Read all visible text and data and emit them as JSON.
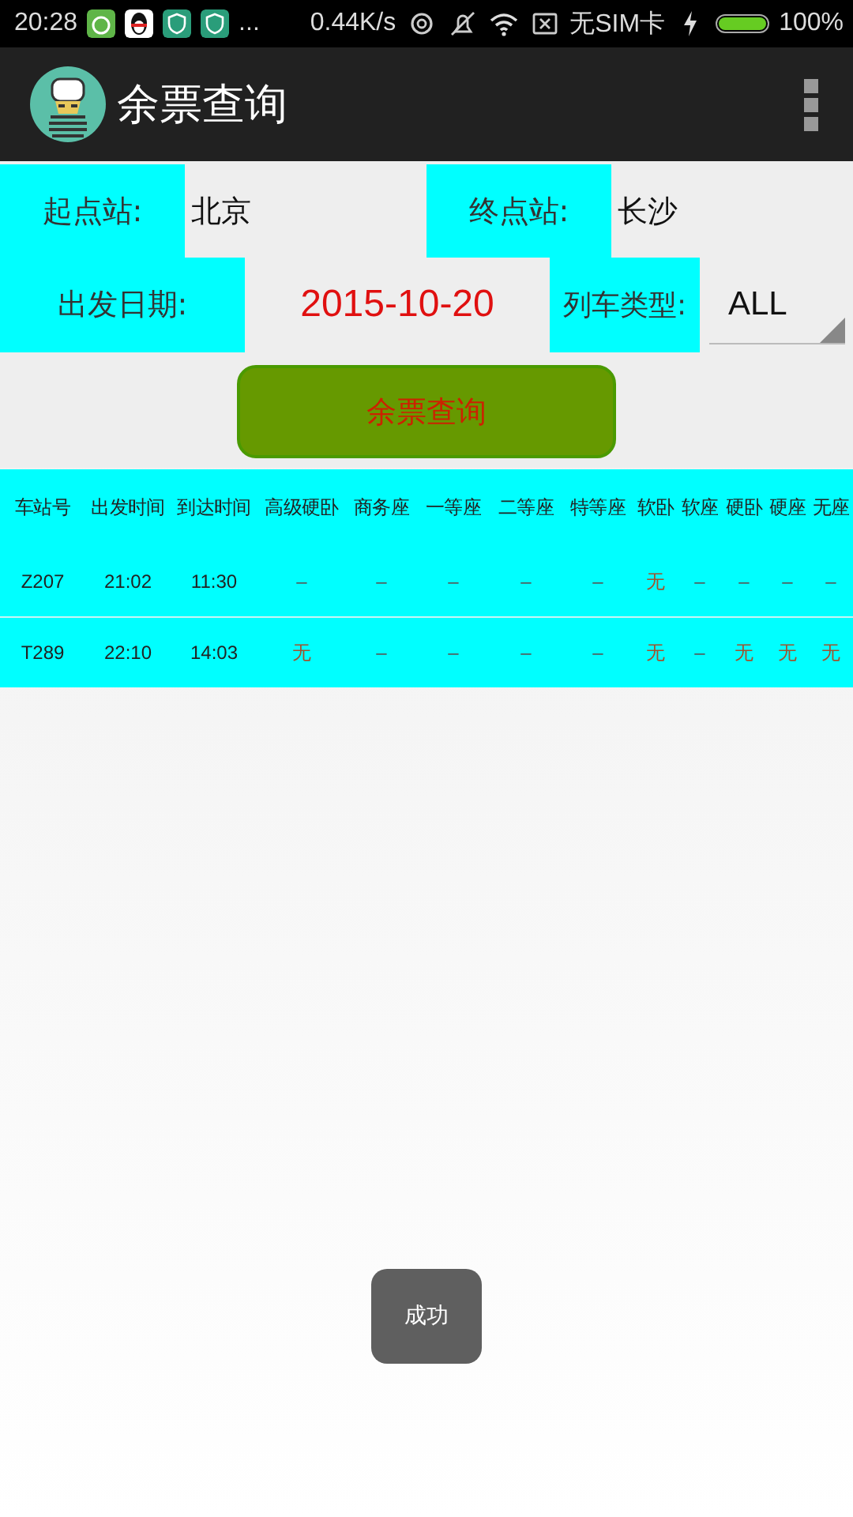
{
  "status_bar": {
    "time": "20:28",
    "more": "...",
    "speed": "0.44K/s",
    "sim": "无SIM卡",
    "battery": {
      "text": "100%",
      "level": 1
    }
  },
  "app_bar": {
    "title": "余票查询"
  },
  "form": {
    "from_label": "起点站:",
    "from_value": "北京",
    "to_label": "终点站:",
    "to_value": "长沙",
    "date_label": "出发日期:",
    "date_value": "2015-10-20",
    "type_label": "列车类型:",
    "type_value": "ALL",
    "button": "余票查询"
  },
  "table": {
    "columns": [
      "车站号",
      "出发时间",
      "到达时间",
      "高级硬卧",
      "商务座",
      "一等座",
      "二等座",
      "特等座",
      "软卧",
      "软座",
      "硬卧",
      "硬座",
      "无座"
    ],
    "rows": [
      {
        "cells": [
          {
            "text": "Z207",
            "kind": "info"
          },
          {
            "text": "21:02",
            "kind": "info"
          },
          {
            "text": "11:30",
            "kind": "info"
          },
          {
            "text": "–",
            "kind": "na"
          },
          {
            "text": "–",
            "kind": "na"
          },
          {
            "text": "–",
            "kind": "na"
          },
          {
            "text": "–",
            "kind": "na"
          },
          {
            "text": "–",
            "kind": "na"
          },
          {
            "text": "无",
            "kind": "sold_out"
          },
          {
            "text": "–",
            "kind": "na"
          },
          {
            "text": "–",
            "kind": "na"
          },
          {
            "text": "–",
            "kind": "na"
          },
          {
            "text": "–",
            "kind": "na"
          }
        ]
      },
      {
        "cells": [
          {
            "text": "T289",
            "kind": "info"
          },
          {
            "text": "22:10",
            "kind": "info"
          },
          {
            "text": "14:03",
            "kind": "info"
          },
          {
            "text": "无",
            "kind": "sold_out"
          },
          {
            "text": "–",
            "kind": "na"
          },
          {
            "text": "–",
            "kind": "na"
          },
          {
            "text": "–",
            "kind": "na"
          },
          {
            "text": "–",
            "kind": "na"
          },
          {
            "text": "无",
            "kind": "sold_out"
          },
          {
            "text": "–",
            "kind": "na"
          },
          {
            "text": "无",
            "kind": "sold_out"
          },
          {
            "text": "无",
            "kind": "sold_out"
          },
          {
            "text": "无",
            "kind": "sold_out"
          }
        ]
      }
    ]
  },
  "toast": {
    "text": "成功"
  }
}
